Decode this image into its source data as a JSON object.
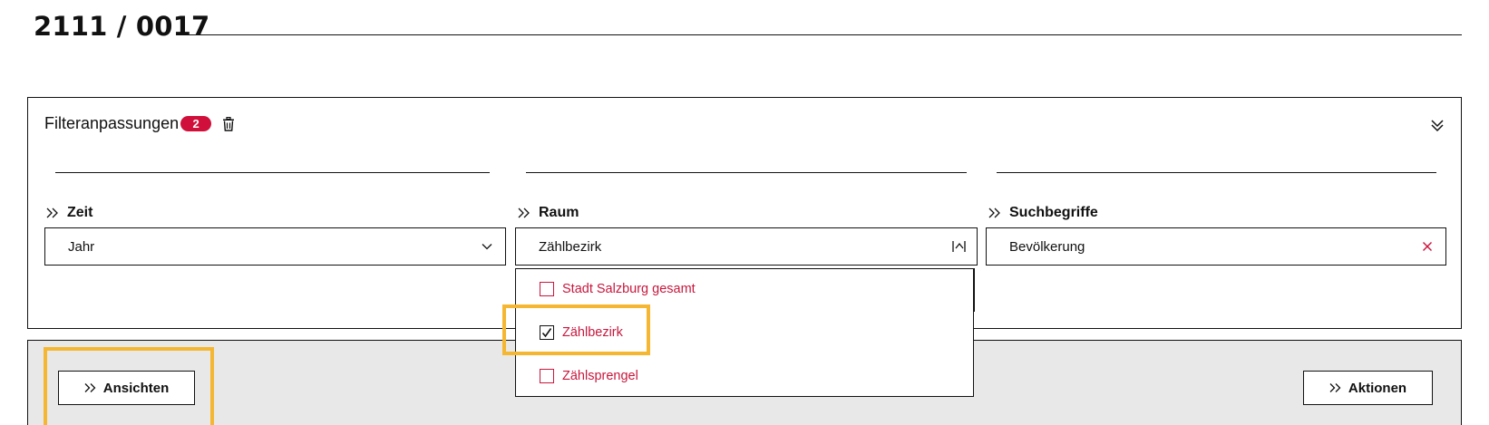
{
  "header": {
    "title": "2111 / 0017"
  },
  "filter": {
    "title": "Filteranpassungen",
    "badge_count": "2",
    "icons": {
      "delete": "trash-icon",
      "collapse": "double-chevron-down-icon"
    }
  },
  "columns": [
    {
      "label": "Zeit",
      "value": "Jahr",
      "trailing_icon": "chevron-down-icon"
    },
    {
      "label": "Raum",
      "value": "Zählbezirk",
      "trailing_icon": "dropdown-toggle-up-icon"
    },
    {
      "label": "Suchbegriffe",
      "value": "Bevölkerung",
      "trailing_icon": "clear-x-icon"
    }
  ],
  "dropdown": {
    "options": [
      {
        "label": "Stadt Salzburg gesamt",
        "checked": false
      },
      {
        "label": "Zählbezirk",
        "checked": true
      },
      {
        "label": "Zählsprengel",
        "checked": false
      }
    ]
  },
  "actions": {
    "views_label": "Ansichten",
    "actions_label": "Aktionen"
  },
  "colors": {
    "accent_red": "#d0103a",
    "option_text": "#c8173d",
    "highlight": "#f5b731",
    "bar_gray": "#e8e8e8"
  }
}
